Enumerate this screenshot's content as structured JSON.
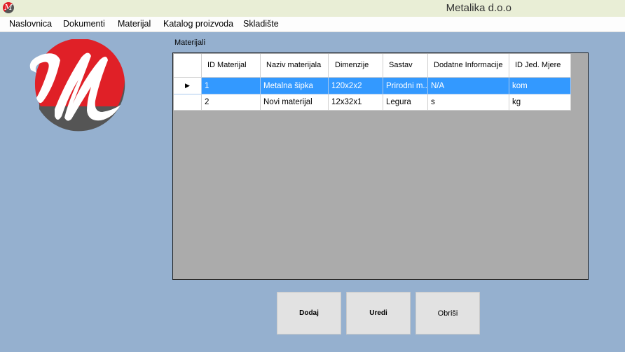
{
  "window": {
    "title": "Metalika d.o.o",
    "icon": "logo-m-icon"
  },
  "menu": [
    "Naslovnica",
    "Dokumenti",
    "Materijal",
    "Katalog proizvoda",
    "Skladište"
  ],
  "section_label": "Materijali",
  "table": {
    "columns": [
      "ID Materijal",
      "Naziv materijala",
      "Dimenzije",
      "Sastav",
      "Dodatne Informacije",
      "ID Jed. Mjere"
    ],
    "rows": [
      [
        "1",
        "Metalna šipka",
        "120x2x2",
        "Prirodni m...",
        "N/A",
        "kom"
      ],
      [
        "2",
        "Novi materijal",
        "12x32x1",
        "Legura",
        "s",
        "kg"
      ]
    ],
    "selected_row": 0,
    "row_indicator": "▶"
  },
  "buttons": {
    "add": "Dodaj",
    "edit": "Uredi",
    "delete": "Obriši"
  },
  "colors": {
    "background": "#95b0cf",
    "selection": "#3399ff",
    "grid_bg": "#ababab",
    "logo_red": "#e02027",
    "logo_gray": "#555555"
  }
}
